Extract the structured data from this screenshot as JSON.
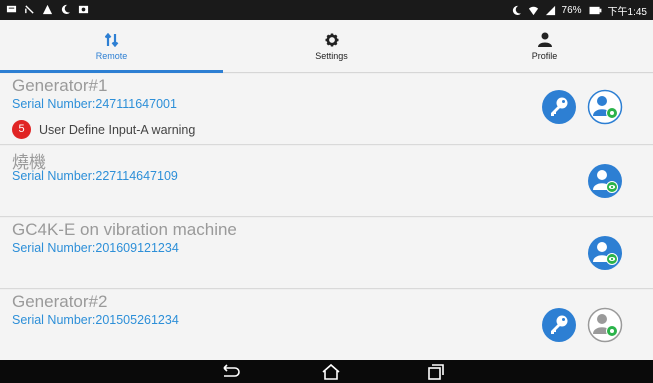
{
  "status_bar": {
    "battery": "76%",
    "time": "下午1:45"
  },
  "tabs": [
    {
      "label": "Remote",
      "icon": "sort-arrows-icon",
      "active": true
    },
    {
      "label": "Settings",
      "icon": "gear-icon",
      "active": false
    },
    {
      "label": "Profile",
      "icon": "person-icon",
      "active": false
    }
  ],
  "devices": [
    {
      "name": "Generator#1",
      "serial": "Serial Number:247111647001",
      "warning_count": "5",
      "warning_text": "User Define Input-A warning"
    },
    {
      "name": "燒機",
      "serial": "Serial Number:227114647109"
    },
    {
      "name": "GC4K-E on vibration machine",
      "serial": "Serial Number:201609121234"
    },
    {
      "name": "Generator#2",
      "serial": "Serial Number:201505261234"
    }
  ],
  "colors": {
    "accent": "#2d7fd3",
    "serial": "#2d8fd8",
    "badge": "#e02424",
    "status_green": "#2bb34a"
  }
}
